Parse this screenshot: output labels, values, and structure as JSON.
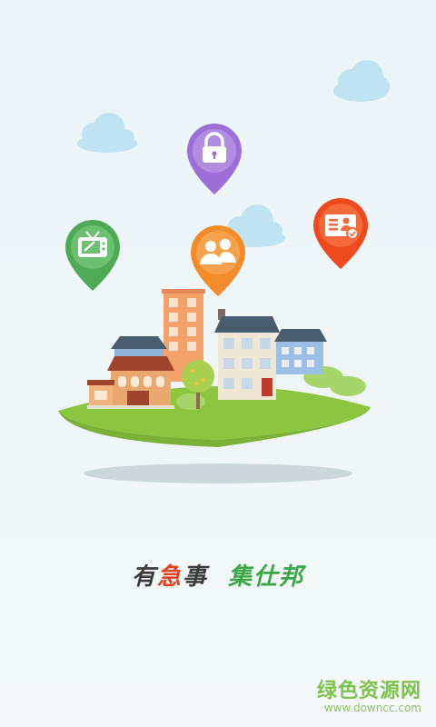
{
  "slogan": {
    "part1": "有",
    "part2": "急",
    "part3": "事",
    "part4": "集仕邦",
    "colors": {
      "dark": "#3b3b3b",
      "red": "#e0421e",
      "green": "#3aa648"
    }
  },
  "icons": {
    "lock": "lock-icon",
    "tv": "tv-repair-icon",
    "people": "people-icon",
    "id_card": "id-card-icon"
  },
  "colors": {
    "lock_pin": "#9b6fd6",
    "tv_pin": "#4eaa55",
    "people_pin": "#f28c2b",
    "card_pin": "#ee4a1e",
    "island": "#8cc63f",
    "cloud": "#b9e0ef"
  },
  "watermark": {
    "title": "绿色资源网",
    "url": "www.downcc.com"
  }
}
